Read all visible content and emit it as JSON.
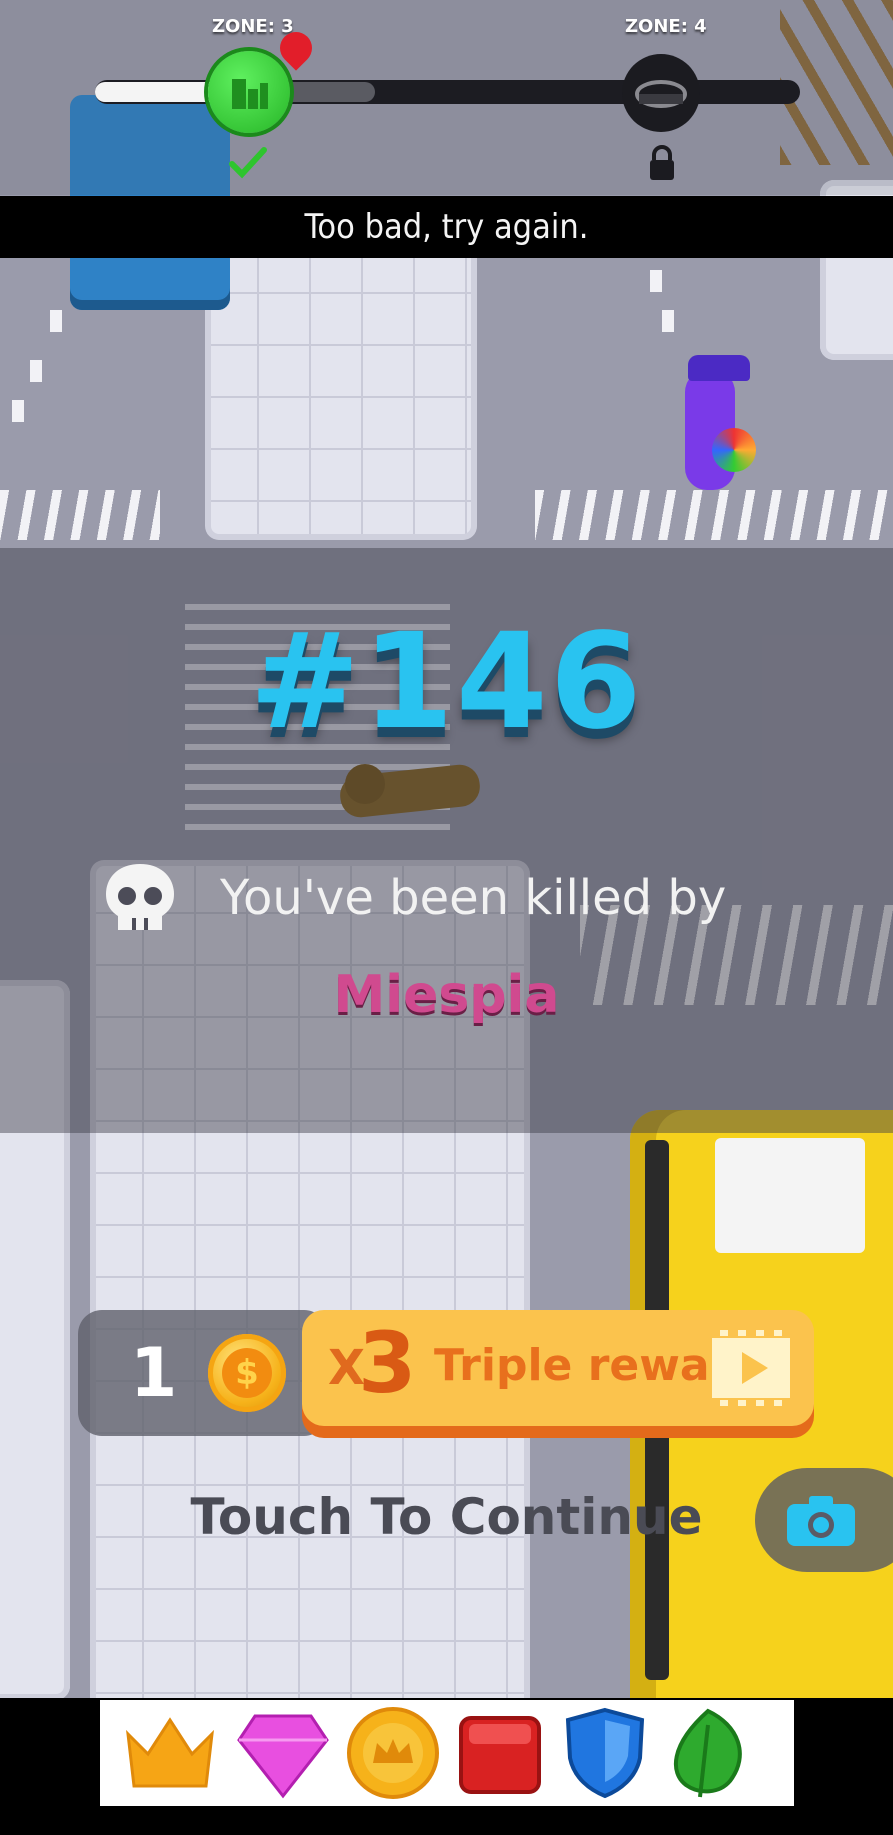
{
  "hud": {
    "zone_current_label": "ZONE: 3",
    "zone_next_label": "ZONE: 4",
    "progress": 0.3,
    "zone_current_status": "completed",
    "zone_next_status": "locked"
  },
  "message_bar": {
    "text": "Too bad, try again."
  },
  "result": {
    "rank": "#146",
    "killed_by_label": "You've been killed by",
    "killer_name": "Miespia"
  },
  "reward": {
    "coin_count": "1",
    "coin_icon": "coin-icon",
    "triple_multiplier_x": "X",
    "triple_multiplier_value": "3",
    "triple_label": "Triple reward",
    "video_icon": "video-play-icon"
  },
  "continue_text": "Touch To Continue",
  "camera_icon": "camera-icon",
  "ad_banner": {
    "items": [
      "crown-icon",
      "gem-icon",
      "crown-coin-icon",
      "red-block-icon",
      "shield-icon",
      "leaf-icon"
    ]
  },
  "colors": {
    "rank": "#29c3f0",
    "killer": "#d04a8f",
    "reward_button": "#fbc34d",
    "zone_completed": "#2ec52e"
  }
}
